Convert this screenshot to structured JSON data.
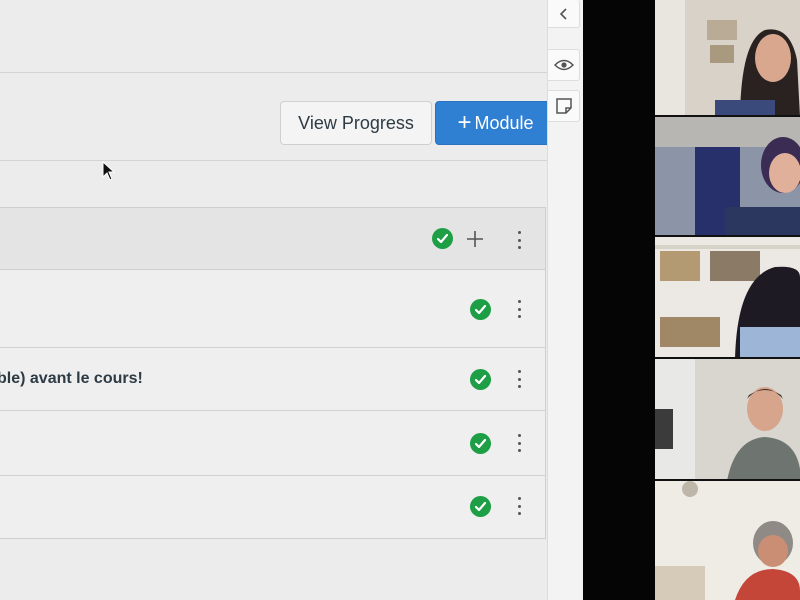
{
  "toolbar": {
    "view_progress_label": "View Progress",
    "add_module_plus": "+",
    "add_module_label": "Module"
  },
  "module": {
    "items": [
      {
        "title": "",
        "published": true
      },
      {
        "title": "ble) avant le cours!",
        "published": true
      },
      {
        "title": "",
        "published": true
      },
      {
        "title": "",
        "published": true
      }
    ],
    "published": true
  },
  "side_tools": {
    "icons": [
      "chevron-left-icon",
      "eye-icon",
      "sticky-note-icon"
    ]
  },
  "video_tiles": [
    {
      "participant": "woman-dark-hair",
      "bg": "#d8d2c8"
    },
    {
      "participant": "woman-glasses-curtain",
      "bg": "#8c94a8"
    },
    {
      "participant": "woman-bookshelf",
      "bg": "#c9bfae"
    },
    {
      "participant": "man-gray-shirt",
      "bg": "#d9d6d0"
    },
    {
      "participant": "woman-glasses-red",
      "bg": "#e4e0da"
    }
  ],
  "colors": {
    "primary_button": "#2f7fd3",
    "published_green": "#1e9e45",
    "text": "#2d3b45"
  }
}
